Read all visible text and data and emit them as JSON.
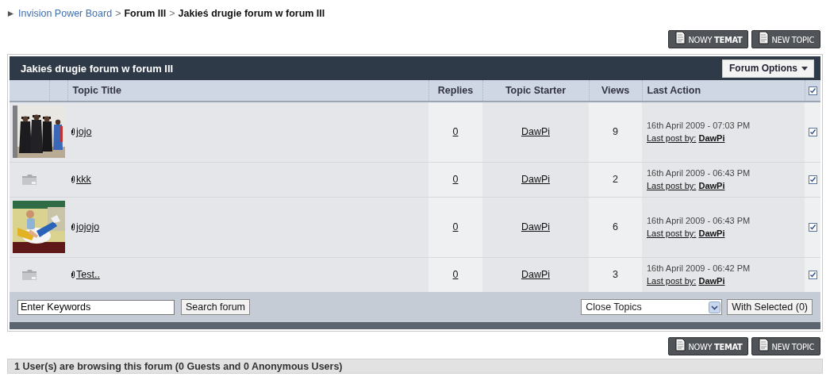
{
  "breadcrumb": [
    {
      "kind": "link",
      "label": "Invision Power Board"
    },
    {
      "kind": "separator",
      "label": ">"
    },
    {
      "kind": "text",
      "label": "Forum III"
    },
    {
      "kind": "separator",
      "label": ">"
    },
    {
      "kind": "text",
      "label": "Jakieś drugie forum w forum III"
    }
  ],
  "top_buttons": [
    {
      "label": "NOWY **TEMAT**"
    },
    {
      "label": "NEW TOPIC"
    }
  ],
  "forum": {
    "title": "Jakieś drugie forum w forum III",
    "options_button": "Forum Options",
    "columns": [
      "Topic Title",
      "Replies",
      "Topic Starter",
      "Views",
      "Last Action"
    ],
    "select_all": {
      "checked": true
    },
    "rows": [
      {
        "kind": "picture",
        "attachment": true,
        "title": "jojo",
        "replies": "0",
        "starter": "DawPi",
        "views": "9",
        "last_date": "16th April 2009 - 07:03 PM",
        "last_post_label": "Last post by:",
        "last_poster": "DawPi",
        "checked": true
      },
      {
        "kind": "folder",
        "attachment": true,
        "title": "kkk",
        "replies": "0",
        "starter": "DawPi",
        "views": "2",
        "last_date": "16th April 2009 - 06:43 PM",
        "last_post_label": "Last post by:",
        "last_poster": "DawPi",
        "checked": true
      },
      {
        "kind": "picture",
        "attachment": true,
        "title": "jojojo",
        "replies": "0",
        "starter": "DawPi",
        "views": "6",
        "last_date": "16th April 2009 - 06:43 PM",
        "last_post_label": "Last post by:",
        "last_poster": "DawPi",
        "checked": true
      },
      {
        "kind": "folder",
        "attachment": true,
        "title": "Test..",
        "replies": "0",
        "starter": "DawPi",
        "views": "3",
        "last_date": "16th April 2009 - 06:42 PM",
        "last_post_label": "Last post by:",
        "last_poster": "DawPi",
        "checked": true
      }
    ],
    "search_field": {
      "value": "Enter Keywords"
    },
    "search_button": "Search forum",
    "action_select": "Close Topics",
    "with_selected_button": "With Selected (0)"
  },
  "bottom_buttons": [
    {
      "label": "NOWY **TEMAT**"
    },
    {
      "label": "NEW TOPIC"
    }
  ],
  "browsing": "1 User(s) are browsing this forum (0 Guests and 0 Anonymous Users)"
}
